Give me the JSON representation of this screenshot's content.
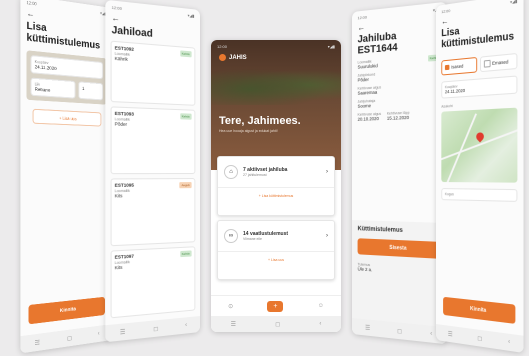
{
  "statusbar": {
    "time": "12:00",
    "icons": "▾◢▮"
  },
  "screen1": {
    "title": "Lisa küttimistulemus",
    "field1_label": "Kuupäev",
    "field1_value": "24.11.2020",
    "field2_label": "Liik",
    "field2_value": "Rebane",
    "field3_value": "1",
    "add_label": "+ Lisa uus",
    "save": "Kinnita"
  },
  "screen2": {
    "title": "Jahiload",
    "permits": [
      {
        "id": "EST1092",
        "label": "Loomaliik",
        "value": "Kährik",
        "badge": "Kehtiv",
        "type": "green"
      },
      {
        "id": "EST1093",
        "label": "Loomaliik",
        "value": "Põder",
        "badge": "Kehtiv",
        "type": "green"
      },
      {
        "id": "EST1095",
        "label": "Loomaliik",
        "value": "Kits",
        "badge": "Aegub",
        "type": "orange"
      },
      {
        "id": "EST1097",
        "label": "Loomaliik",
        "value": "Kits",
        "badge": "Kehtiv",
        "type": "green"
      }
    ]
  },
  "screen3": {
    "logo": "JAHIS",
    "greeting": "Tere, Jahimees.",
    "subtitle": "Hea uue hooaja algust ja edukat jahti!",
    "card1_title": "7 aktiivset jahiluba",
    "card1_sub": "27 jahitulemust",
    "card1_add": "+ Lisa küttimistulemus",
    "card2_title": "14 vaatlustulemust",
    "card2_sub": "Viimane eile",
    "card2_add": "+ Lisa uus"
  },
  "screen4": {
    "title": "Jahiluba EST1644",
    "fields": [
      {
        "label": "Loomaliik",
        "value": "Suurulukid"
      },
      {
        "label": "Jahipiirkond",
        "value": "Põder"
      },
      {
        "label": "Kehtivuse algus",
        "value": "Saaremaa"
      },
      {
        "label": "Jahijuhataja",
        "value": "Soome"
      },
      {
        "label": "Kehtivuse algus",
        "value": "20.10.2020"
      },
      {
        "label": "Kehtivuse lõpp",
        "value": "15.12.2020"
      }
    ],
    "badge": "Kehtiv",
    "section": "Küttimistulemus",
    "save": "Sisesta",
    "result_label": "Tulemus",
    "result_value": "Üle 2 a."
  },
  "screen5": {
    "title": "Lisa küttimistulemus",
    "option1": "Isased",
    "option2": "Emased",
    "date_label": "Kuupäev",
    "date_value": "24.11.2020",
    "location_label": "Asukoht",
    "count_label": "Kogus",
    "save": "Kinnita"
  }
}
